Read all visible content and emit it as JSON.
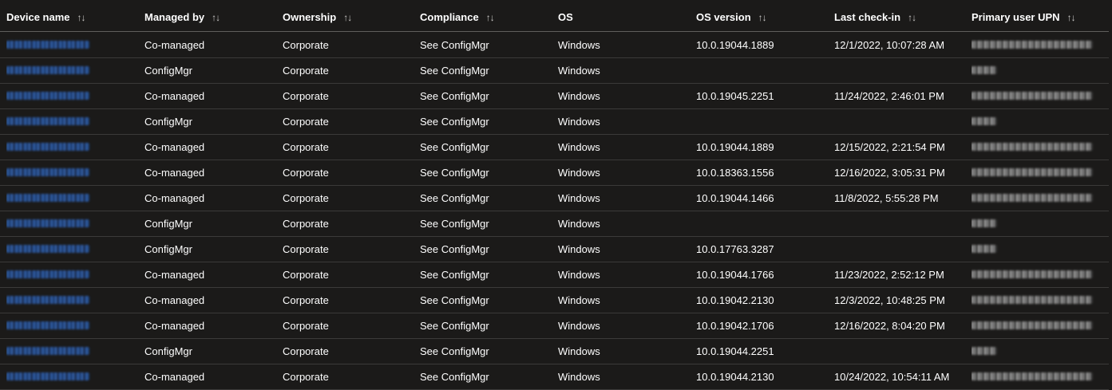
{
  "columns": [
    {
      "label": "Device name",
      "sortable": true
    },
    {
      "label": "Managed by",
      "sortable": true
    },
    {
      "label": "Ownership",
      "sortable": true
    },
    {
      "label": "Compliance",
      "sortable": true
    },
    {
      "label": "OS",
      "sortable": false
    },
    {
      "label": "OS version",
      "sortable": true
    },
    {
      "label": "Last check-in",
      "sortable": true
    },
    {
      "label": "Primary user UPN",
      "sortable": true
    }
  ],
  "sort_icon": "sort-arrows-icon",
  "colors": {
    "background": "#1b1a19",
    "row_divider": "#3b3a39",
    "header_divider": "#605e5c",
    "link": "#2f5fa8",
    "text": "#ffffff"
  },
  "rows": [
    {
      "managed_by": "Co-managed",
      "ownership": "Corporate",
      "compliance": "See ConfigMgr",
      "os": "Windows",
      "os_version": "10.0.19044.1889",
      "last_checkin": "12/1/2022, 10:07:28 AM",
      "user": "long"
    },
    {
      "managed_by": "ConfigMgr",
      "ownership": "Corporate",
      "compliance": "See ConfigMgr",
      "os": "Windows",
      "os_version": "",
      "last_checkin": "",
      "user": "short"
    },
    {
      "managed_by": "Co-managed",
      "ownership": "Corporate",
      "compliance": "See ConfigMgr",
      "os": "Windows",
      "os_version": "10.0.19045.2251",
      "last_checkin": "11/24/2022, 2:46:01 PM",
      "user": "long"
    },
    {
      "managed_by": "ConfigMgr",
      "ownership": "Corporate",
      "compliance": "See ConfigMgr",
      "os": "Windows",
      "os_version": "",
      "last_checkin": "",
      "user": "short"
    },
    {
      "managed_by": "Co-managed",
      "ownership": "Corporate",
      "compliance": "See ConfigMgr",
      "os": "Windows",
      "os_version": "10.0.19044.1889",
      "last_checkin": "12/15/2022, 2:21:54 PM",
      "user": "long"
    },
    {
      "managed_by": "Co-managed",
      "ownership": "Corporate",
      "compliance": "See ConfigMgr",
      "os": "Windows",
      "os_version": "10.0.18363.1556",
      "last_checkin": "12/16/2022, 3:05:31 PM",
      "user": "long"
    },
    {
      "managed_by": "Co-managed",
      "ownership": "Corporate",
      "compliance": "See ConfigMgr",
      "os": "Windows",
      "os_version": "10.0.19044.1466",
      "last_checkin": "11/8/2022, 5:55:28 PM",
      "user": "long"
    },
    {
      "managed_by": "ConfigMgr",
      "ownership": "Corporate",
      "compliance": "See ConfigMgr",
      "os": "Windows",
      "os_version": "",
      "last_checkin": "",
      "user": "short"
    },
    {
      "managed_by": "ConfigMgr",
      "ownership": "Corporate",
      "compliance": "See ConfigMgr",
      "os": "Windows",
      "os_version": "10.0.17763.3287",
      "last_checkin": "",
      "user": "short"
    },
    {
      "managed_by": "Co-managed",
      "ownership": "Corporate",
      "compliance": "See ConfigMgr",
      "os": "Windows",
      "os_version": "10.0.19044.1766",
      "last_checkin": "11/23/2022, 2:52:12 PM",
      "user": "long"
    },
    {
      "managed_by": "Co-managed",
      "ownership": "Corporate",
      "compliance": "See ConfigMgr",
      "os": "Windows",
      "os_version": "10.0.19042.2130",
      "last_checkin": "12/3/2022, 10:48:25 PM",
      "user": "long"
    },
    {
      "managed_by": "Co-managed",
      "ownership": "Corporate",
      "compliance": "See ConfigMgr",
      "os": "Windows",
      "os_version": "10.0.19042.1706",
      "last_checkin": "12/16/2022, 8:04:20 PM",
      "user": "long"
    },
    {
      "managed_by": "ConfigMgr",
      "ownership": "Corporate",
      "compliance": "See ConfigMgr",
      "os": "Windows",
      "os_version": "10.0.19044.2251",
      "last_checkin": "",
      "user": "short"
    },
    {
      "managed_by": "Co-managed",
      "ownership": "Corporate",
      "compliance": "See ConfigMgr",
      "os": "Windows",
      "os_version": "10.0.19044.2130",
      "last_checkin": "10/24/2022, 10:54:11 AM",
      "user": "long"
    }
  ]
}
